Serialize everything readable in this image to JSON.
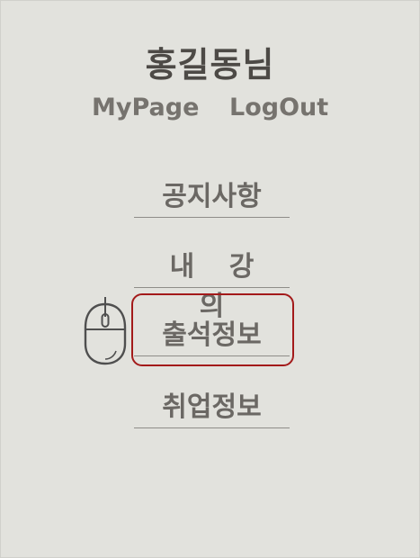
{
  "user": {
    "name": "홍길동님"
  },
  "account": {
    "mypage_label": "MyPage",
    "logout_label": "LogOut"
  },
  "menu": {
    "items": [
      {
        "label": "공지사항"
      },
      {
        "label": "내 강 의"
      },
      {
        "label": "출석정보"
      },
      {
        "label": "취업정보"
      }
    ]
  },
  "colors": {
    "background": "#e2e2dd",
    "highlight_border": "#a31a1a",
    "text_primary": "#4d4a46"
  },
  "icons": {
    "cursor_hint": "mouse-icon"
  }
}
